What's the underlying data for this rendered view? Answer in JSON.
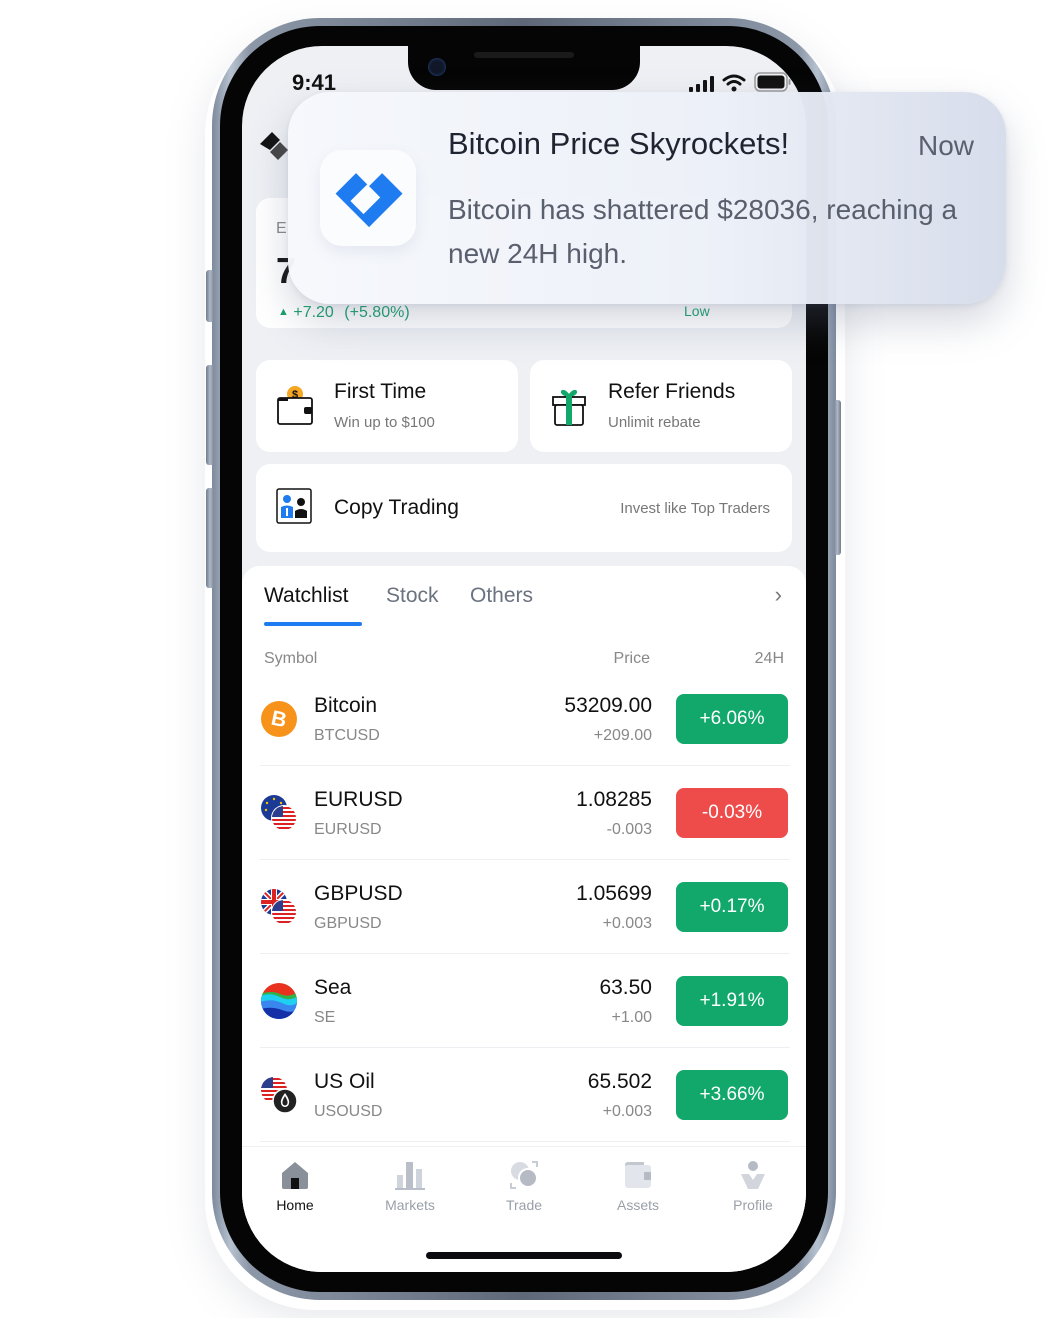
{
  "status_bar": {
    "time": "9:41"
  },
  "hero": {
    "label_partial": "E",
    "value_partial": "7",
    "change": "+7.20",
    "change_pct": "(+5.80%)",
    "low_label": "Low"
  },
  "promos": {
    "first_time": {
      "title": "First Time",
      "subtitle": "Win up to $100"
    },
    "refer": {
      "title": "Refer Friends",
      "subtitle": "Unlimit rebate"
    },
    "copy_trading": {
      "title": "Copy Trading",
      "subtitle": "Invest like Top Traders"
    }
  },
  "watchlist": {
    "tabs": [
      {
        "label": "Watchlist",
        "active": true
      },
      {
        "label": "Stock",
        "active": false
      },
      {
        "label": "Others",
        "active": false
      }
    ],
    "more_glyph": "›",
    "columns": {
      "symbol": "Symbol",
      "price": "Price",
      "change": "24H"
    },
    "rows": [
      {
        "name": "Bitcoin",
        "symbol": "BTCUSD",
        "price": "53209.00",
        "delta": "+209.00",
        "pct": "+6.06%",
        "direction": "up",
        "icon": "bitcoin-icon"
      },
      {
        "name": "EURUSD",
        "symbol": "EURUSD",
        "price": "1.08285",
        "delta": "-0.003",
        "pct": "-0.03%",
        "direction": "down",
        "icon": "eu-us-flag-icon"
      },
      {
        "name": "GBPUSD",
        "symbol": "GBPUSD",
        "price": "1.05699",
        "delta": "+0.003",
        "pct": "+0.17%",
        "direction": "up",
        "icon": "uk-us-flag-icon"
      },
      {
        "name": "Sea",
        "symbol": "SE",
        "price": "63.50",
        "delta": "+1.00",
        "pct": "+1.91%",
        "direction": "up",
        "icon": "sea-logo-icon"
      },
      {
        "name": "US Oil",
        "symbol": "USOUSD",
        "price": "65.502",
        "delta": "+0.003",
        "pct": "+3.66%",
        "direction": "up",
        "icon": "us-oil-icon"
      }
    ]
  },
  "nav": [
    {
      "label": "Home",
      "icon": "home-icon",
      "active": true
    },
    {
      "label": "Markets",
      "icon": "markets-icon",
      "active": false
    },
    {
      "label": "Trade",
      "icon": "trade-icon",
      "active": false
    },
    {
      "label": "Assets",
      "icon": "wallet-icon",
      "active": false
    },
    {
      "label": "Profile",
      "icon": "profile-icon",
      "active": false
    }
  ],
  "notification": {
    "title": "Bitcoin Price Skyrockets!",
    "time": "Now",
    "body": "Bitcoin has shattered $28036, reaching a new 24H high."
  },
  "colors": {
    "accent": "#1e7cf0",
    "up": "#12a86b",
    "down": "#ee4b4b",
    "up_text": "#17a06a"
  }
}
